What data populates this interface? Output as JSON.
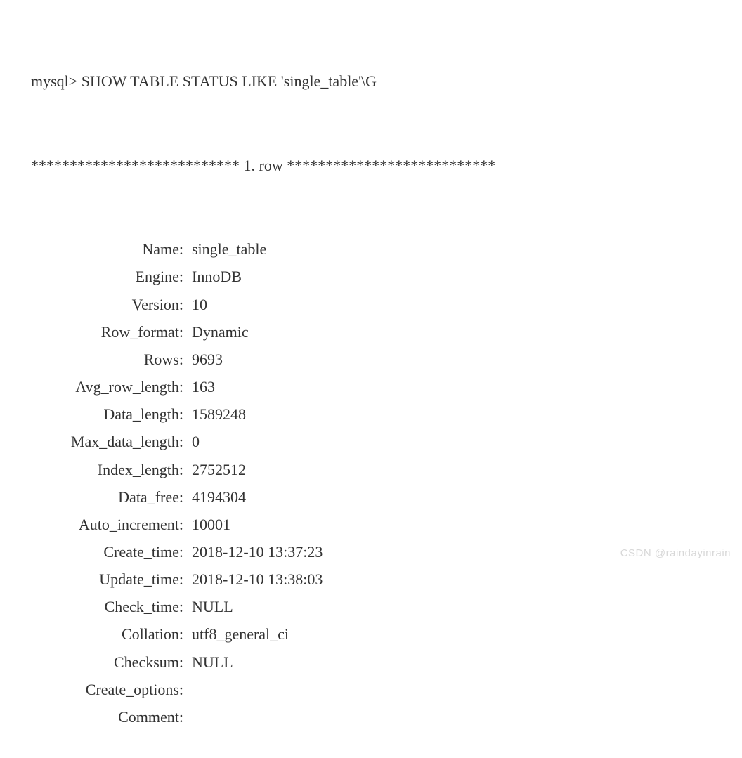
{
  "prompt": "mysql> SHOW TABLE STATUS LIKE 'single_table'\\G",
  "separator": "*************************** 1. row ***************************",
  "fields": [
    {
      "label": "Name:",
      "value": "single_table"
    },
    {
      "label": "Engine:",
      "value": "InnoDB"
    },
    {
      "label": "Version:",
      "value": "10"
    },
    {
      "label": "Row_format:",
      "value": "Dynamic"
    },
    {
      "label": "Rows:",
      "value": "9693"
    },
    {
      "label": "Avg_row_length:",
      "value": "163"
    },
    {
      "label": "Data_length:",
      "value": "1589248"
    },
    {
      "label": "Max_data_length:",
      "value": "0"
    },
    {
      "label": "Index_length:",
      "value": "2752512"
    },
    {
      "label": "Data_free:",
      "value": "4194304"
    },
    {
      "label": "Auto_increment:",
      "value": "10001"
    },
    {
      "label": "Create_time:",
      "value": "2018-12-10 13:37:23"
    },
    {
      "label": "Update_time:",
      "value": "2018-12-10 13:38:03"
    },
    {
      "label": "Check_time:",
      "value": "NULL"
    },
    {
      "label": "Collation:",
      "value": "utf8_general_ci"
    },
    {
      "label": "Checksum:",
      "value": "NULL"
    },
    {
      "label": "Create_options:",
      "value": ""
    },
    {
      "label": "Comment:",
      "value": ""
    }
  ],
  "watermark": "CSDN @raindayinrain"
}
